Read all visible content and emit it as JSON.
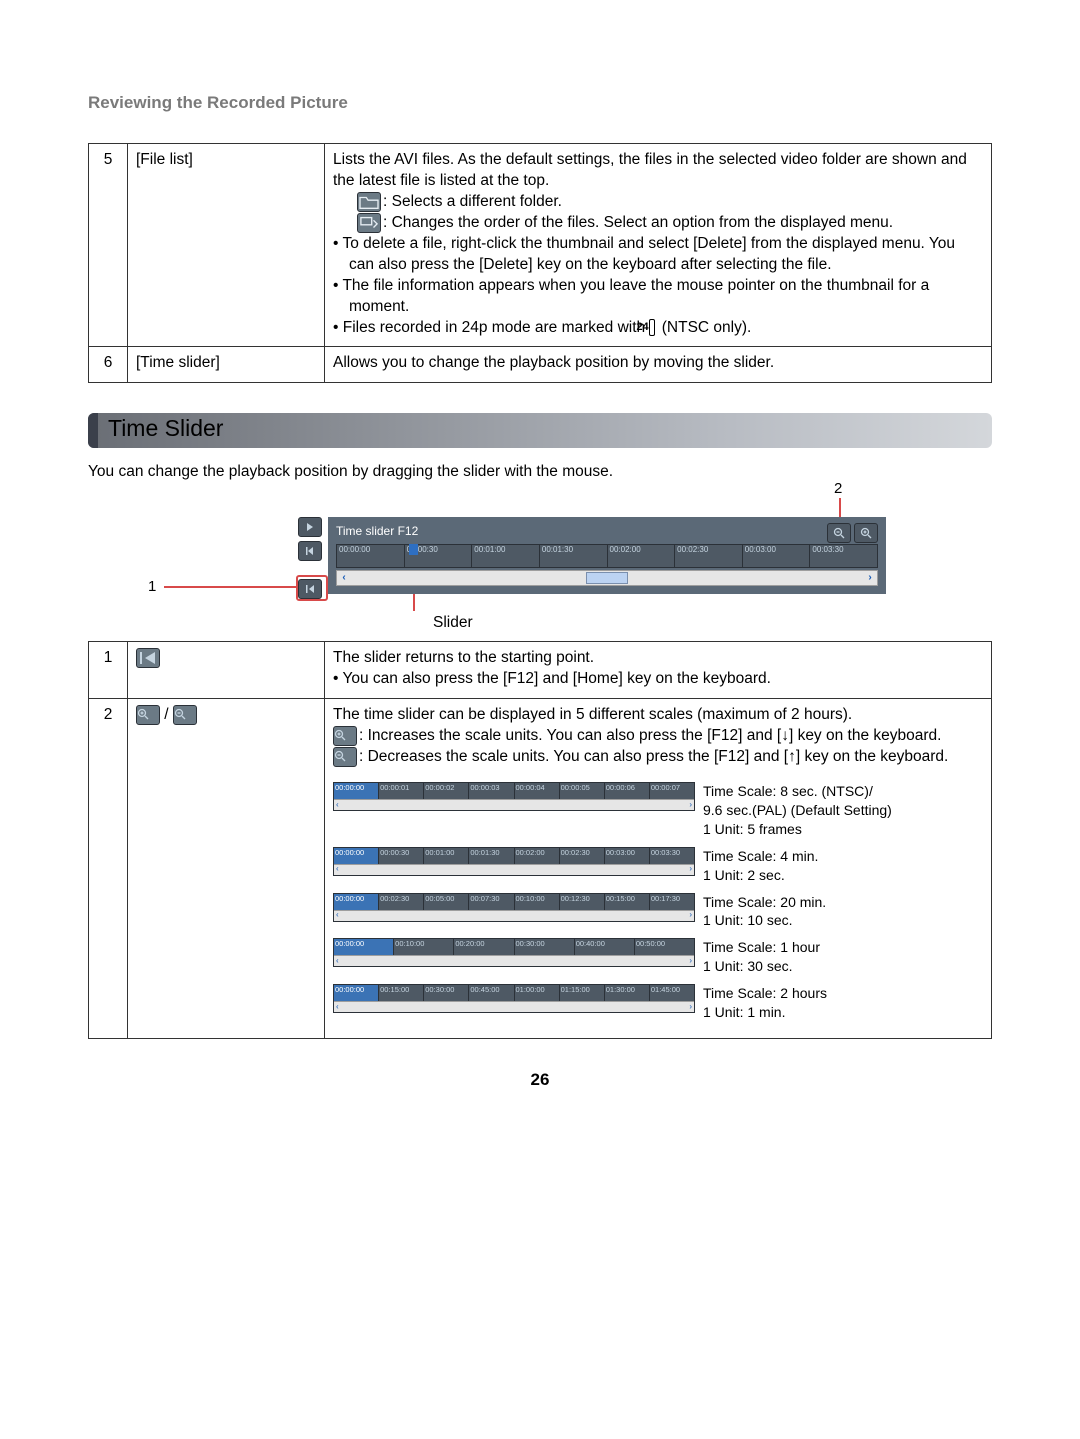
{
  "header": "Reviewing the Recorded Picture",
  "top_table": {
    "rows": [
      {
        "num": "5",
        "label": "[File list]",
        "intro": "Lists the AVI files. As the default settings, the files in the selected video folder are shown and the latest file is listed at the top.",
        "folder_text": ": Selects a different folder.",
        "sort_text": ": Changes the order of the files. Select an option from the displayed menu.",
        "bullet1": "To delete a file, right-click the thumbnail and select [Delete] from the displayed menu. You can also press the [Delete] key on the keyboard after selecting the file.",
        "bullet2": "The file information appears when you leave the mouse pointer on the thumbnail for a moment.",
        "bullet3a": "Files recorded in 24p mode are marked with ",
        "bullet3b": " (NTSC only)."
      },
      {
        "num": "6",
        "label": "[Time slider]",
        "desc": "Allows you to change the playback position by moving the slider."
      }
    ]
  },
  "time_slider": {
    "title": "Time Slider",
    "intro": "You can change the playback position by dragging the slider with the mouse.",
    "panel_title": "Time slider F12",
    "ticks": [
      "00:00:00",
      "00:00:30",
      "00:01:00",
      "00:01:30",
      "00:02:00",
      "00:02:30",
      "00:03:00",
      "00:03:30"
    ],
    "callout_top": "2",
    "callout_left": "1",
    "caption": "Slider"
  },
  "lower_table": {
    "row1": {
      "num": "1",
      "desc_line1": "The slider returns to the starting point.",
      "desc_bullet": "You can also press the [F12] and [Home] key on the keyboard."
    },
    "row2": {
      "num": "2",
      "intro": "The time slider can be displayed in 5 different scales (maximum of 2 hours).",
      "zoom_in_text": ": Increases the scale units. You can also press the [F12] and [↓] key on the keyboard.",
      "zoom_out_text": ": Decreases the scale units. You can also press the [F12] and [↑] key on the keyboard.",
      "scales": [
        {
          "ticks": [
            "00:00:00",
            "00:00:01",
            "00:00:02",
            "00:00:03",
            "00:00:04",
            "00:00:05",
            "00:00:06",
            "00:00:07"
          ],
          "info_l1": "Time Scale: 8 sec. (NTSC)/",
          "info_l2": "9.6 sec.(PAL) (Default Setting)",
          "info_l3": "1 Unit: 5 frames"
        },
        {
          "ticks": [
            "00:00:00",
            "00:00:30",
            "00:01:00",
            "00:01:30",
            "00:02:00",
            "00:02:30",
            "00:03:00",
            "00:03:30"
          ],
          "info_l1": "Time Scale: 4 min.",
          "info_l2": "1 Unit: 2 sec.",
          "info_l3": ""
        },
        {
          "ticks": [
            "00:00:00",
            "00:02:30",
            "00:05:00",
            "00:07:30",
            "00:10:00",
            "00:12:30",
            "00:15:00",
            "00:17:30"
          ],
          "info_l1": "Time Scale: 20 min.",
          "info_l2": "1 Unit: 10 sec.",
          "info_l3": ""
        },
        {
          "ticks": [
            "00:00:00",
            "00:10:00",
            "00:20:00",
            "00:30:00",
            "00:40:00",
            "00:50:00"
          ],
          "info_l1": "Time Scale: 1 hour",
          "info_l2": "1 Unit: 30 sec.",
          "info_l3": ""
        },
        {
          "ticks": [
            "00:00:00",
            "00:15:00",
            "00:30:00",
            "00:45:00",
            "01:00:00",
            "01:15:00",
            "01:30:00",
            "01:45:00"
          ],
          "info_l1": "Time Scale: 2 hours",
          "info_l2": "1 Unit: 1 min.",
          "info_l3": ""
        }
      ]
    }
  },
  "page_number": "26"
}
